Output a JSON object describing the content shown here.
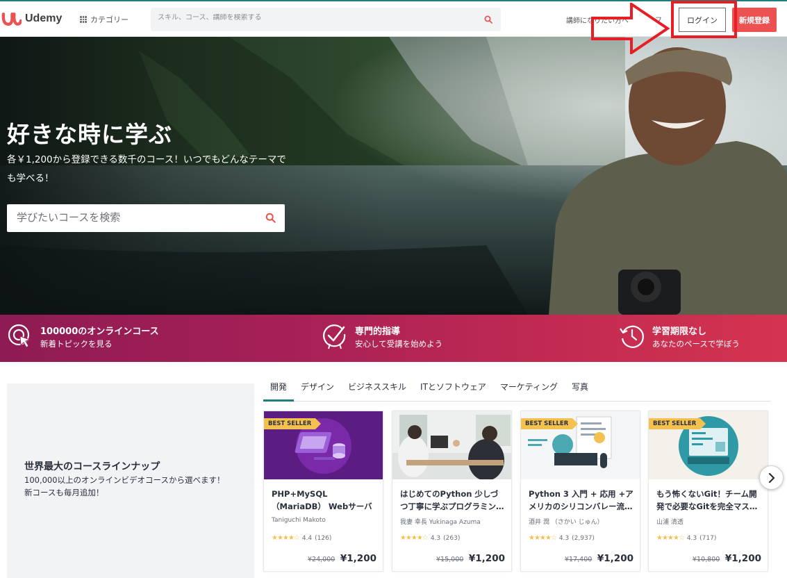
{
  "header": {
    "logo_text": "Udemy",
    "categories_label": "カテゴリー",
    "search_placeholder": "スキル、コース、講師を検索する",
    "teach_label": "講師になりたい方へ",
    "cart_fragment": "フ",
    "login_label": "ログイン",
    "signup_label": "新規登録"
  },
  "hero": {
    "title": "好きな時に学ぶ",
    "subtitle": "各￥1,200から登録できる数千のコース！いつでもどんなテーマでも学べる！",
    "search_placeholder": "学びたいコースを検索"
  },
  "features": [
    {
      "title": "100000のオンラインコース",
      "subtitle": "新着トピックを見る",
      "icon": "target-cursor-icon"
    },
    {
      "title": "専門的指導",
      "subtitle": "安心して受講を始めよう",
      "icon": "check-badge-icon"
    },
    {
      "title": "学習期限なし",
      "subtitle": "あなたのペースで学ぼう",
      "icon": "history-clock-icon"
    }
  ],
  "lineup": {
    "title": "世界最大のコースラインナップ",
    "description": "100,000以上のオンラインビデオコースから選べます！ 新コースも毎月追加！"
  },
  "tabs": [
    "開発",
    "デザイン",
    "ビジネススキル",
    "ITとソフトウェア",
    "マーケティング",
    "写真"
  ],
  "active_tab": "開発",
  "courses": [
    {
      "badge": "BEST SELLER",
      "title": "PHP+MySQL（MariaDB） Webサーバーサイドプロ…",
      "author": "Taniguchi Makoto",
      "rating": "4.4",
      "reviews": "(126)",
      "old_price": "¥24,000",
      "price": "¥1,200"
    },
    {
      "badge": "",
      "title": "はじめてのPython 少しづつ丁寧に学ぶプログラミン…",
      "author": "我妻 幸長 Yukinaga Azuma",
      "rating": "4.3",
      "reviews": "(263)",
      "old_price": "¥15,000",
      "price": "¥1,200"
    },
    {
      "badge": "BEST SELLER",
      "title": "Python 3 入門 + 応用 +アメリカのシリコンバレー流…",
      "author": "酒井 潤 （さかい じゅん）",
      "rating": "4.3",
      "reviews": "(2,937)",
      "old_price": "¥17,400",
      "price": "¥1,200"
    },
    {
      "badge": "BEST SELLER",
      "title": "もう怖くないGit！チーム開発で必要なGitを完全マス…",
      "author": "山浦 清透",
      "rating": "4.3",
      "reviews": "(717)",
      "old_price": "¥10,800",
      "price": "¥1,200"
    }
  ],
  "colors": {
    "brand": "#ec5252",
    "teal": "#1d7f7a",
    "highlight": "#e81e25",
    "badge": "#f4c150"
  }
}
